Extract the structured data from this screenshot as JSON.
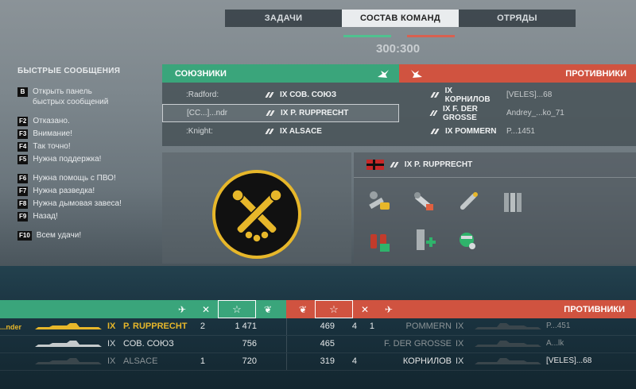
{
  "tabs": [
    {
      "label": "ЗАДАЧИ"
    },
    {
      "label": "СОСТАВ КОМАНД",
      "active": true
    },
    {
      "label": "ОТРЯДЫ"
    }
  ],
  "score": "300:300",
  "quick_messages": {
    "title": "БЫСТРЫЕ СООБЩЕНИЯ",
    "items": [
      {
        "key": "B",
        "label": "Открыть панель быстрых сообщений"
      },
      {
        "key": "F2",
        "label": "Отказано."
      },
      {
        "key": "F3",
        "label": "Внимание!"
      },
      {
        "key": "F4",
        "label": "Так точно!"
      },
      {
        "key": "F5",
        "label": "Нужна поддержка!"
      },
      {
        "key": "F6",
        "label": "Нужна помощь с ПВО!"
      },
      {
        "key": "F7",
        "label": "Нужна разведка!"
      },
      {
        "key": "F8",
        "label": "Нужна дымовая завеса!"
      },
      {
        "key": "F9",
        "label": "Назад!"
      },
      {
        "key": "F10",
        "label": "Всем удачи!"
      }
    ]
  },
  "allies": {
    "title": "СОЮЗНИКИ",
    "rows": [
      {
        "player": ":Radford:",
        "ship": "IX СОВ. СОЮЗ"
      },
      {
        "player": "[СС...]...ndr",
        "ship": "IX P. RUPPRECHT",
        "selected": true
      },
      {
        "player": ":Knight:",
        "ship": "IX ALSACE"
      }
    ]
  },
  "enemies": {
    "title": "ПРОТИВНИКИ",
    "rows": [
      {
        "ship": "IX КОРНИЛОВ",
        "player": "[VELES]...68"
      },
      {
        "ship": "IX F. DER GROSSE",
        "player": "Andrey_...ko_71"
      },
      {
        "ship": "IX POMMERN",
        "player": "P...1451"
      }
    ]
  },
  "selected_ship": {
    "name": "IX P. RUPPRECHT",
    "flag": "germany-naval-flag"
  },
  "modules": [
    {
      "icon": "main-battery-mod-icon"
    },
    {
      "icon": "aux-armament-mod-icon"
    },
    {
      "icon": "torpedo-mod-icon"
    },
    {
      "icon": "armor-plate-icon"
    },
    {
      "icon": "damage-control-icon"
    },
    {
      "icon": "repair-party-icon"
    },
    {
      "icon": "spotter-plane-icon"
    }
  ],
  "board": {
    "ally_header_icons": [
      "plane-icon",
      "kills-icon",
      "star-icon",
      "laurel-icon"
    ],
    "enemy_header_icons": [
      "laurel-icon",
      "star-icon",
      "kills-icon",
      "plane-icon"
    ],
    "enemy_title": "ПРОТИВНИКИ",
    "ally_rows": [
      {
        "player": "...nder",
        "tier": "IX",
        "ship": "P. RUPPRECHT",
        "kills": "2",
        "score": "1 471",
        "me": true
      },
      {
        "player": "",
        "tier": "IX",
        "ship": "СОВ. СОЮЗ",
        "kills": "",
        "score": "756"
      },
      {
        "player": "",
        "tier": "IX",
        "ship": "ALSACE",
        "kills": "1",
        "score": "720",
        "dead": true
      }
    ],
    "enemy_rows": [
      {
        "score": "469",
        "kills": "4",
        "planes": "1",
        "ship": "POMMERN",
        "tier": "IX",
        "player": "P...451",
        "dead": true
      },
      {
        "score": "465",
        "kills": "",
        "planes": "",
        "ship": "F. DER GROSSE",
        "tier": "IX",
        "player": "A...lk",
        "dead": true
      },
      {
        "score": "319",
        "kills": "4",
        "planes": "",
        "ship": "КОРНИЛОВ",
        "tier": "IX",
        "player": "[VELES]...68"
      }
    ]
  },
  "colors": {
    "ally": "#3aa57b",
    "enemy": "#d05340",
    "highlight": "#e7b72a"
  }
}
